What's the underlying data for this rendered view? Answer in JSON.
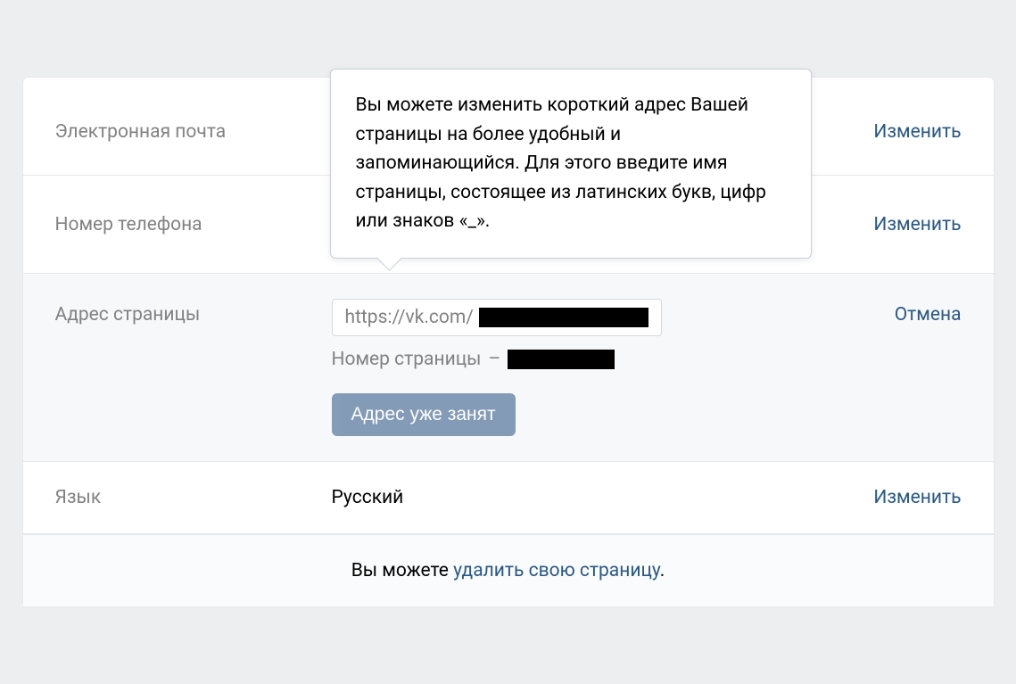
{
  "rows": {
    "email": {
      "label": "Электронная почта",
      "action": "Изменить"
    },
    "phone": {
      "label": "Номер телефона",
      "action": "Изменить"
    },
    "address": {
      "label": "Адрес страницы",
      "action": "Отмена",
      "url_prefix": "https://vk.com/",
      "page_number_prefix": "Номер страницы",
      "dash": "–",
      "status_button": "Адрес уже занят"
    },
    "language": {
      "label": "Язык",
      "value": "Русский",
      "action": "Изменить"
    }
  },
  "tooltip": "Вы можете изменить короткий адрес Вашей страницы на более удобный и запоминающийся. Для этого введите имя страницы, состоящее из латинских букв, цифр или знаков «_».",
  "footer": {
    "prefix": "Вы можете ",
    "link": "удалить свою страницу",
    "suffix": "."
  }
}
